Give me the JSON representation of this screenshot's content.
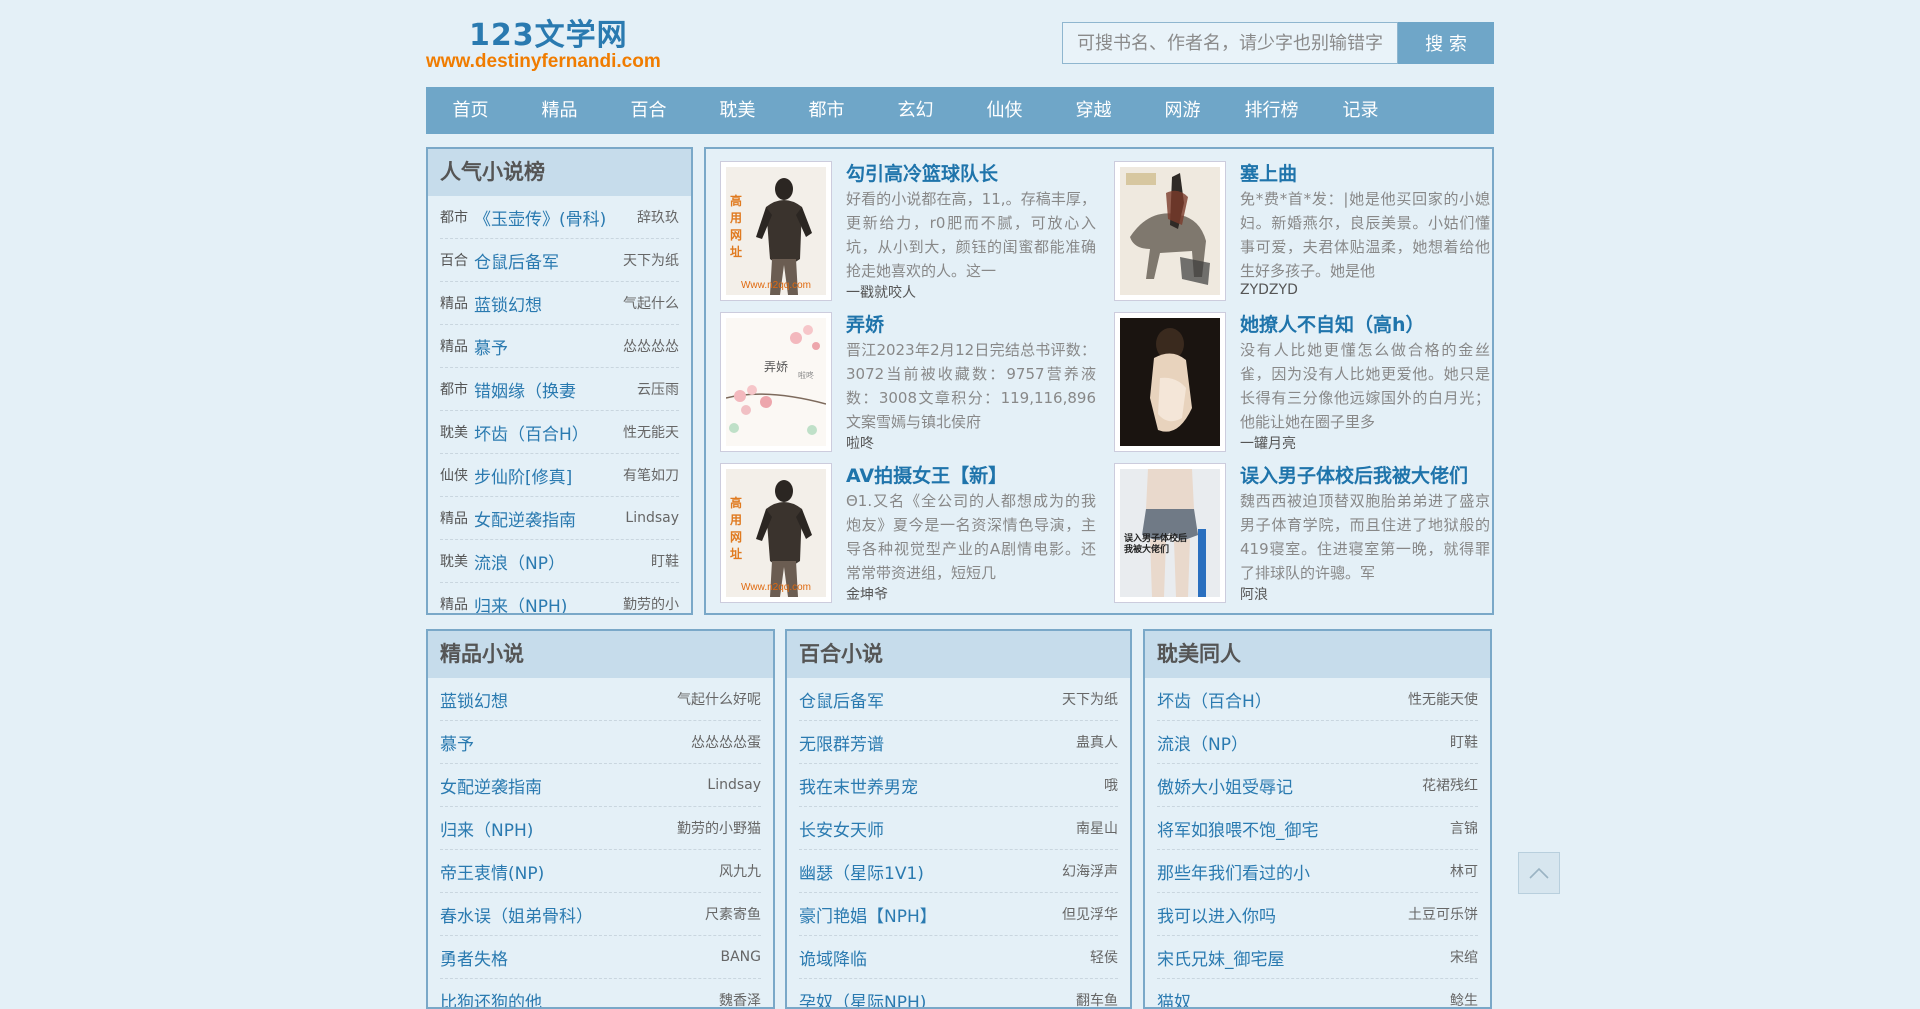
{
  "site": {
    "title": "123文学网",
    "url": "www.destinyfernandi.com"
  },
  "search": {
    "placeholder": "可搜书名、作者名，请少字也别输错字",
    "button": "搜 索"
  },
  "nav": [
    "首页",
    "精品",
    "百合",
    "耽美",
    "都市",
    "玄幻",
    "仙侠",
    "穿越",
    "网游",
    "排行榜",
    "记录"
  ],
  "popular": {
    "title": "人气小说榜",
    "items": [
      {
        "cat": "都市",
        "title": "《玉壶传》(骨科)",
        "author": "辞玖玖"
      },
      {
        "cat": "百合",
        "title": "仓鼠后备军",
        "author": "天下为纸"
      },
      {
        "cat": "精品",
        "title": "蓝锁幻想",
        "author": "气起什么"
      },
      {
        "cat": "精品",
        "title": "慕予",
        "author": "怂怂怂怂"
      },
      {
        "cat": "都市",
        "title": "错姻缘（换妻",
        "author": "云压雨"
      },
      {
        "cat": "耽美",
        "title": "坏齿（百合H）",
        "author": "性无能天"
      },
      {
        "cat": "仙侠",
        "title": "步仙阶[修真]",
        "author": "有笔如刀"
      },
      {
        "cat": "精品",
        "title": "女配逆袭指南",
        "author": "Lindsay"
      },
      {
        "cat": "耽美",
        "title": "流浪（NP）",
        "author": "盯鞋"
      },
      {
        "cat": "精品",
        "title": "归来（NPH)",
        "author": "勤劳的小"
      }
    ]
  },
  "featured": [
    {
      "title": "勾引高冷篮球队长",
      "desc": "好看的小说都在高，11,。存稿丰厚，更新给力，r0肥而不腻，可放心入坑，从小到大，颜钰的闺蜜都能准确抢走她喜欢的人。这一",
      "author": "一戳就咬人",
      "cover": "n2qq"
    },
    {
      "title": "塞上曲",
      "desc": "免*费*首*发：|她是他买回家的小媳妇。新婚燕尔，良辰美景。小姑们懂事可爱，夫君体贴温柔，她想着给他生好多孩子。她是他",
      "author": "ZYDZYD",
      "cover": "horse"
    },
    {
      "title": "弄娇",
      "desc": "晋江2023年2月12日完结总书评数：3072当前被收藏数：9757营养液数：3008文章积分：119,116,896文案雪嫣与镇北侯府",
      "author": "啦咚",
      "cover": "flower"
    },
    {
      "title": "她撩人不自知（高h）",
      "desc": "没有人比她更懂怎么做合格的金丝雀，因为没有人比她更爱他。她只是长得有三分像他远嫁国外的白月光；他能让她在圈子里多",
      "author": "一罐月亮",
      "cover": "dark"
    },
    {
      "title": "AV拍摄女王【新】",
      "desc": "Θ1.又名《全公司的人都想成为的我炮友》夏今是一名资深情色导演，主导各种视觉型产业的A剧情电影。还常常带资进组，短短几",
      "author": "金坤爷",
      "cover": "n2qq"
    },
    {
      "title": "误入男子体校后我被大佬们",
      "desc": "魏西西被迫顶替双胞胎弟弟进了盛京男子体育学院，而且住进了地狱般的419寝室。住进寝室第一晚，就得罪了排球队的许骢。军",
      "author": "阿浪",
      "cover": "body"
    }
  ],
  "cover_text": {
    "n2qq_side": "高用网址",
    "n2qq_url": "Www.n2qq.com",
    "flower_title": "弄娇",
    "flower_author": "啦咚",
    "body_text": "误入男子体校后我被大佬们"
  },
  "columns": [
    {
      "title": "精品小说",
      "items": [
        {
          "title": "蓝锁幻想",
          "author": "气起什么好呢"
        },
        {
          "title": "慕予",
          "author": "怂怂怂怂蛋"
        },
        {
          "title": "女配逆袭指南",
          "author": "Lindsay"
        },
        {
          "title": "归来（NPH)",
          "author": "勤劳的小野猫"
        },
        {
          "title": "帝王衷情(NP)",
          "author": "风九九"
        },
        {
          "title": "春水误（姐弟骨科）",
          "author": "尺素寄鱼"
        },
        {
          "title": "勇者失格",
          "author": "BANG"
        },
        {
          "title": "比狗还狗的他",
          "author": "魏香泽"
        }
      ]
    },
    {
      "title": "百合小说",
      "items": [
        {
          "title": "仓鼠后备军",
          "author": "天下为纸"
        },
        {
          "title": "无限群芳谱",
          "author": "蛊真人"
        },
        {
          "title": "我在末世养男宠",
          "author": "哦"
        },
        {
          "title": "长安女天师",
          "author": "南星山"
        },
        {
          "title": "幽瑟（星际1V1)",
          "author": "幻海浮声"
        },
        {
          "title": "豪门艳娼【NPH】",
          "author": "但见浮华"
        },
        {
          "title": "诡域降临",
          "author": "轻侯"
        },
        {
          "title": "孕奴（星际NPH)",
          "author": "翻车鱼"
        }
      ]
    },
    {
      "title": "耽美同人",
      "items": [
        {
          "title": "坏齿（百合H）",
          "author": "性无能天使"
        },
        {
          "title": "流浪（NP）",
          "author": "盯鞋"
        },
        {
          "title": "傲娇大小姐受辱记",
          "author": "花裙残红"
        },
        {
          "title": "将军如狼喂不饱_御宅",
          "author": "言锦"
        },
        {
          "title": "那些年我们看过的小",
          "author": "林可"
        },
        {
          "title": "我可以进入你吗",
          "author": "土豆可乐饼"
        },
        {
          "title": "宋氏兄妹_御宅屋",
          "author": "宋绾"
        },
        {
          "title": "猫奴",
          "author": "鲶生"
        }
      ]
    }
  ]
}
